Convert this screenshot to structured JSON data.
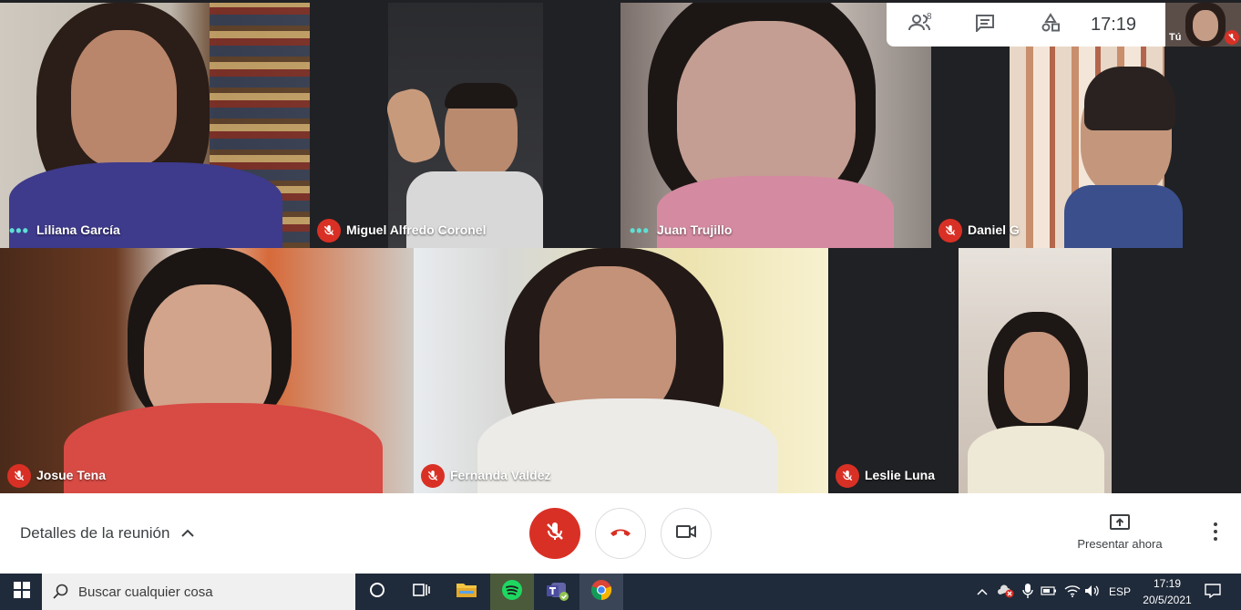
{
  "participants": [
    {
      "name": "Liliana García",
      "state": "speaking"
    },
    {
      "name": "Miguel Alfredo Coronel",
      "state": "muted"
    },
    {
      "name": "Juan Trujillo",
      "state": "speaking"
    },
    {
      "name": "Daniel G",
      "state": "muted"
    },
    {
      "name": "Josue Tena",
      "state": "muted"
    },
    {
      "name": "Fernanda Valdez",
      "state": "muted"
    },
    {
      "name": "Leslie Luna",
      "state": "muted"
    }
  ],
  "topbar": {
    "people_icon": "people-icon",
    "people_count": "8",
    "chat_icon": "chat-icon",
    "activities_icon": "activities-icon",
    "time": "17:19",
    "self_label": "Tú"
  },
  "controls": {
    "details_label": "Detalles de la reunión",
    "mic_icon": "mic-off-icon",
    "hangup_icon": "hangup-icon",
    "camera_icon": "camera-icon",
    "present_label": "Presentar ahora",
    "more_icon": "more-vert-icon"
  },
  "taskbar": {
    "search_placeholder": "Buscar cualquier cosa",
    "language": "ESP",
    "time": "17:19",
    "date": "20/5/2021"
  },
  "colors": {
    "mute_red": "#d93025",
    "speaking_teal": "#5fe0d4",
    "stage_bg": "#202124",
    "taskbar_bg": "#1f2a3a"
  }
}
